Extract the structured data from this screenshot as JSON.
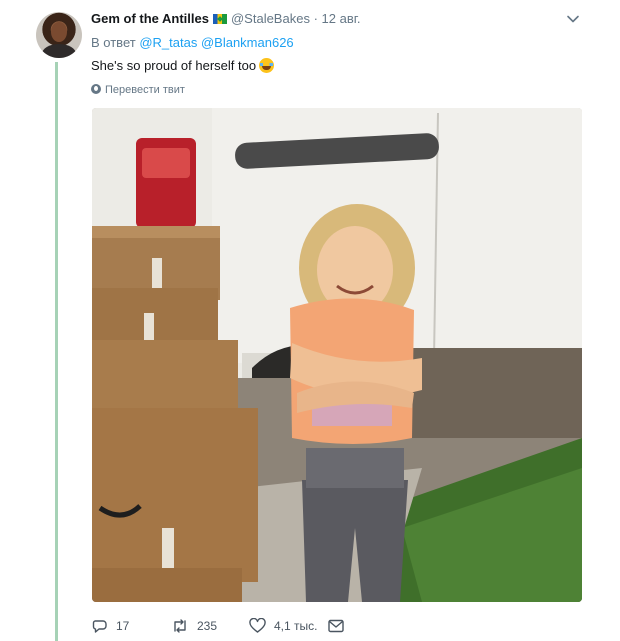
{
  "tweet": {
    "display_name": "Gem of the Antilles",
    "handle": "@StaleBakes",
    "separator": "·",
    "date": "12 авг.",
    "reply_prefix": "В ответ",
    "reply_to": [
      "@R_tatas",
      "@Blankman626"
    ],
    "text": "She's so proud of herself too",
    "translate_label": "Перевести твит",
    "photo_alt": "Girl hugging herself next to a stack of boxes"
  },
  "actions": {
    "replies": "17",
    "retweets": "235",
    "likes": "4,1 тыс."
  },
  "icons": {
    "menu": "chevron-down-icon",
    "reply": "reply-icon",
    "retweet": "retweet-icon",
    "like": "heart-icon",
    "dm": "envelope-icon",
    "translate": "globe-icon"
  },
  "colors": {
    "link": "#1da1f2",
    "secondary_text": "#657786",
    "thread_line": "#a6d2b6"
  }
}
